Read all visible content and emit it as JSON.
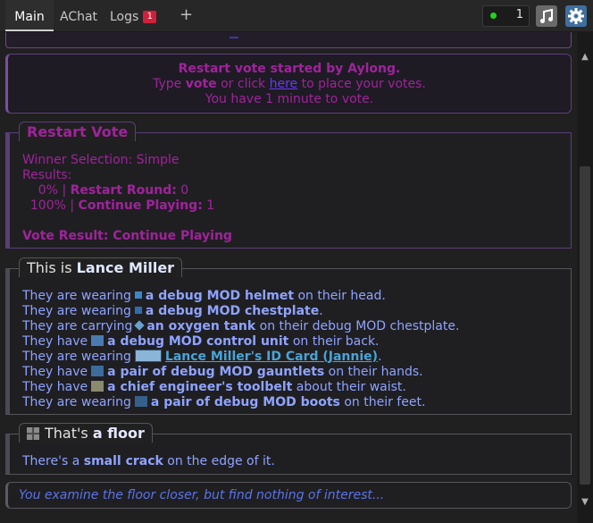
{
  "tabs": {
    "main": "Main",
    "achat": "AChat",
    "logs": "Logs",
    "logs_badge": "1",
    "add": "+"
  },
  "status": {
    "ping_count": "1",
    "music_icon": "music-note-icon",
    "settings_icon": "gear-icon"
  },
  "colors": {
    "vote_purple": "#a0239b",
    "link_blue": "#6a36ff",
    "examine_blue": "#8fa3ff",
    "accent": "#3f6f9f"
  },
  "vote_notice": {
    "line1": "Restart vote started by Aylong.",
    "line2_pre": "Type ",
    "line2_cmd": "vote",
    "line2_mid": " or click ",
    "line2_link": "here",
    "line2_post": " to place your votes.",
    "line3": "You have 1 minute to vote."
  },
  "restart_vote": {
    "title": "Restart Vote",
    "winner_selection": "Winner Selection: Simple",
    "results_label": "Results:",
    "r1_pct": "    0% | ",
    "r1_name": "Restart Round:",
    "r1_count": " 0",
    "r2_pct": "  100% | ",
    "r2_name": "Continue Playing:",
    "r2_count": " 1",
    "result_label": "Vote Result:",
    "result_value": " Continue Playing"
  },
  "examine": {
    "title_pre": "This is ",
    "title_name": "Lance Miller",
    "items": [
      {
        "pre": "They are wearing",
        "item": "a debug MOD helmet",
        "post": " on their head."
      },
      {
        "pre": "They are wearing",
        "item": "a debug MOD chestplate",
        "post": "."
      },
      {
        "pre": "They are carrying",
        "item": "an oxygen tank",
        "post": " on their debug MOD chestplate."
      },
      {
        "pre": "They have",
        "item": "a debug MOD control unit",
        "post": " on their back."
      },
      {
        "pre": "They are wearing",
        "item": "Lance Miller's ID Card (Jannie)",
        "post": "."
      },
      {
        "pre": "They have",
        "item": "a pair of debug MOD gauntlets",
        "post": " on their hands."
      },
      {
        "pre": "They have",
        "item": "a chief engineer's toolbelt",
        "post": " about their waist."
      },
      {
        "pre": "They are wearing",
        "item": "a pair of debug MOD boots",
        "post": " on their feet."
      }
    ]
  },
  "floor": {
    "title_pre": "That's ",
    "title_name": "a floor",
    "desc_pre": "There's a ",
    "desc_bold": "small crack",
    "desc_post": " on the edge of it."
  },
  "closer": "You examine the floor closer, but find nothing of interest..."
}
